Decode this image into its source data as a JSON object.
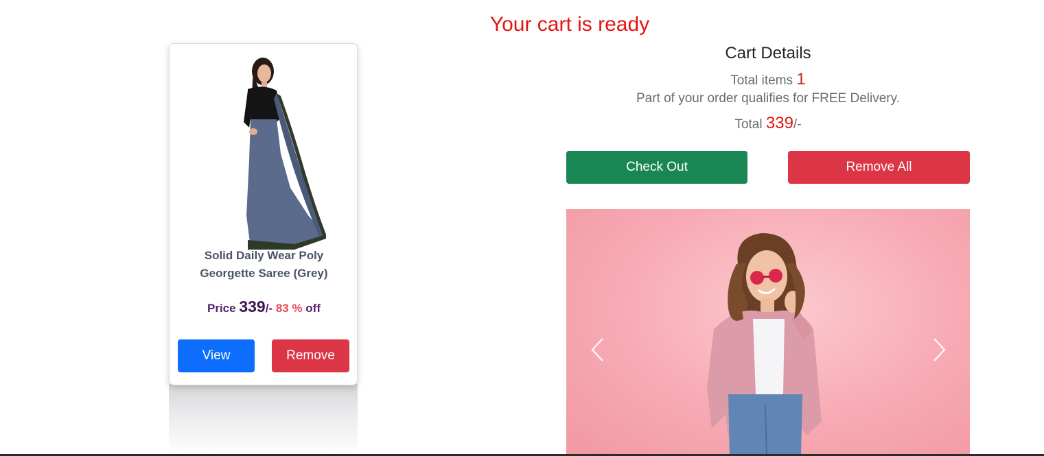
{
  "header": {
    "title": "Your cart is ready"
  },
  "product": {
    "title": "Solid Daily Wear Poly Georgette Saree (Grey)",
    "price_label": "Price",
    "price": "339",
    "price_suffix": "/-",
    "discount": "83 %",
    "discount_suffix": "off",
    "view_label": "View",
    "remove_label": "Remove"
  },
  "cart": {
    "title": "Cart Details",
    "items_label": "Total items",
    "items_count": "1",
    "delivery_note": "Part of your order qualifies for FREE Delivery.",
    "total_label": "Total",
    "total": "339",
    "total_suffix": "/-",
    "checkout_label": "Check Out",
    "remove_all_label": "Remove All"
  },
  "carousel": {
    "prev_icon": "chevron-left-icon",
    "next_icon": "chevron-right-icon"
  },
  "colors": {
    "headline": "#e4140f",
    "view_button": "#0d6efd",
    "danger_button": "#dc3545",
    "checkout_button": "#198754",
    "price_purple": "#55206a"
  }
}
